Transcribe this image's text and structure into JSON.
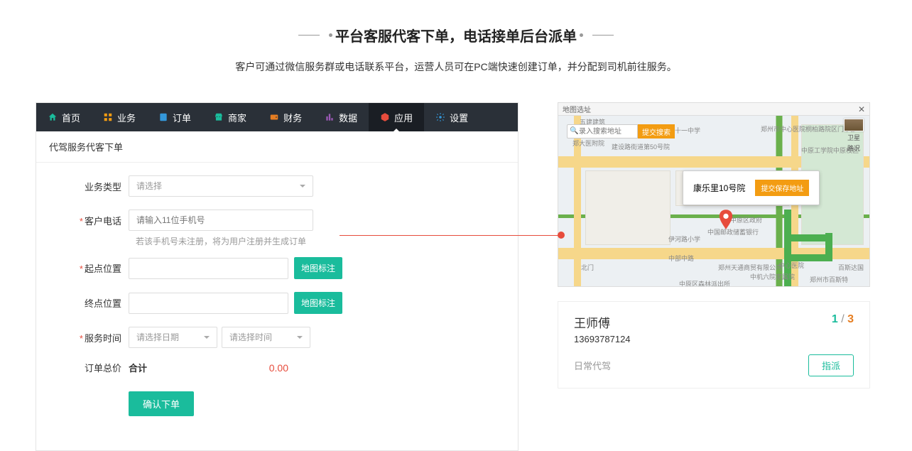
{
  "header": {
    "title": "平台客服代客下单，电话接单后台派单",
    "subtitle": "客户可通过微信服务群或电话联系平台，运营人员可在PC端快速创建订单，并分配到司机前往服务。"
  },
  "nav": {
    "items": [
      {
        "label": "首页",
        "icon": "home",
        "color": "#1abc9c"
      },
      {
        "label": "业务",
        "icon": "grid",
        "color": "#f39c12"
      },
      {
        "label": "订单",
        "icon": "list",
        "color": "#3498db"
      },
      {
        "label": "商家",
        "icon": "shop",
        "color": "#1abc9c"
      },
      {
        "label": "财务",
        "icon": "wallet",
        "color": "#e67e22"
      },
      {
        "label": "数据",
        "icon": "chart",
        "color": "#9b59b6"
      },
      {
        "label": "应用",
        "icon": "cube",
        "color": "#e74c3c",
        "active": true
      },
      {
        "label": "设置",
        "icon": "gear",
        "color": "#3498db"
      }
    ]
  },
  "page_header": "代驾服务代客下单",
  "form": {
    "biz_type": {
      "label": "业务类型",
      "placeholder": "请选择"
    },
    "phone": {
      "label": "客户电话",
      "placeholder": "请输入11位手机号",
      "helper": "若该手机号未注册，将为用户注册并生成订单"
    },
    "start": {
      "label": "起点位置",
      "btn": "地图标注"
    },
    "end": {
      "label": "终点位置",
      "btn": "地图标注"
    },
    "service_time": {
      "label": "服务时间",
      "date_placeholder": "请选择日期",
      "time_placeholder": "请选择时间"
    },
    "total": {
      "label": "订单总价",
      "sum_label": "合计",
      "value": "0.00"
    },
    "submit": "确认下单"
  },
  "map": {
    "header": "地图选址",
    "search_placeholder": "录入搜索地址",
    "search_btn": "提交搜索",
    "layer_label": "卫星",
    "layer_label2": "路况",
    "popup_text": "康乐里10号院",
    "save_btn": "提交保存地址",
    "labels": {
      "a": "郑州市中心医院桐柏路院区门诊部",
      "b": "中原工学院中原校区",
      "c": "中部中路",
      "d": "康乐里",
      "e": "中原区政府",
      "f": "中国邮政储蓄银行",
      "g": "建设路街道第50号院",
      "h": "郑州天通商贸有限公司",
      "i": "中机六院家属院",
      "j": "中心医院",
      "k": "中原区森林派出所",
      "l": "郑州市百斯特",
      "m": "百斯达国",
      "n": "五十一中学",
      "o": "伊河路小学",
      "p": "郑大医附院",
      "q": "五建建筑",
      "r": "北门"
    }
  },
  "driver": {
    "name": "王师傅",
    "phone": "13693787124",
    "current": "1",
    "total": "3",
    "tag": "日常代驾",
    "assign": "指派"
  }
}
